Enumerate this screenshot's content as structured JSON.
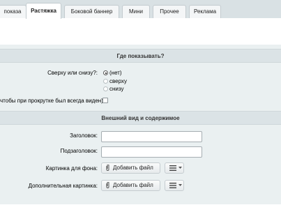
{
  "tabs": [
    {
      "label": "показа"
    },
    {
      "label": "Растяжка"
    },
    {
      "label": "Боковой баннер"
    },
    {
      "label": "Мини"
    },
    {
      "label": "Прочее"
    },
    {
      "label": "Реклама"
    }
  ],
  "sections": {
    "where": {
      "title": "Где показывать?",
      "position_label": "Сверху или снизу?:",
      "options": [
        "(нет)",
        "сверху",
        "снизу"
      ],
      "selected": "(нет)",
      "sticky_label": "чтобы при прокрутке был всегда виден):"
    },
    "look": {
      "title": "Внешний вид и содержимое",
      "heading_label": "Заголовок:",
      "subheading_label": "Подзаголовок:",
      "bg_image_label": "Картинка для фона:",
      "extra_image_label": "Дополнительная картинка:",
      "add_file_label": "Добавить файл"
    }
  },
  "colors": {
    "accent_band": "#eaf0f1",
    "section_header": "#dbe3e6",
    "tab_bar": "#d9e1e4"
  }
}
